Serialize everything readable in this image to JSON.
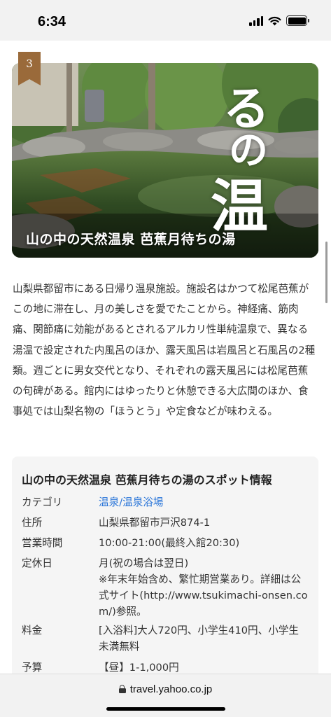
{
  "status_bar": {
    "time": "6:34"
  },
  "hero": {
    "rank": "3",
    "title": "山の中の天然温泉 芭蕉月待ちの湯",
    "overlay_chars": [
      "る",
      "の",
      "温"
    ]
  },
  "description": "山梨県都留市にある日帰り温泉施設。施設名はかつて松尾芭蕉がこの地に滞在し、月の美しさを愛でたことから。神経痛、筋肉痛、関節痛に効能があるとされるアルカリ性単純温泉で、異なる湯温で設定された内風呂のほか、露天風呂は岩風呂と石風呂の2種類。週ごとに男女交代となり、それぞれの露天風呂には松尾芭蕉の句碑がある。館内にはゆったりと休憩できる大広間のほか、食事処では山梨名物の「ほうとう」や定食などが味わえる。",
  "info": {
    "title": "山の中の天然温泉 芭蕉月待ちの湯のスポット情報",
    "rows": [
      {
        "label": "カテゴリ",
        "value": "温泉/温泉浴場"
      },
      {
        "label": "住所",
        "value": "山梨県都留市戸沢874-1"
      },
      {
        "label": "営業時間",
        "value": "10:00-21:00(最終入館20:30)"
      },
      {
        "label": "定休日",
        "value": "月(祝の場合は翌日)\n※年末年始含め、繁忙期営業あり。詳細は公式サイト(http://www.tsukimachi-onsen.com/)参照。"
      },
      {
        "label": "料金",
        "value": "[入浴料]大人720円、小学生410円、小学生未満無料"
      },
      {
        "label": "予算",
        "value": "【昼】1-1,000円"
      }
    ]
  },
  "browser": {
    "url": "travel.yahoo.co.jp"
  }
}
